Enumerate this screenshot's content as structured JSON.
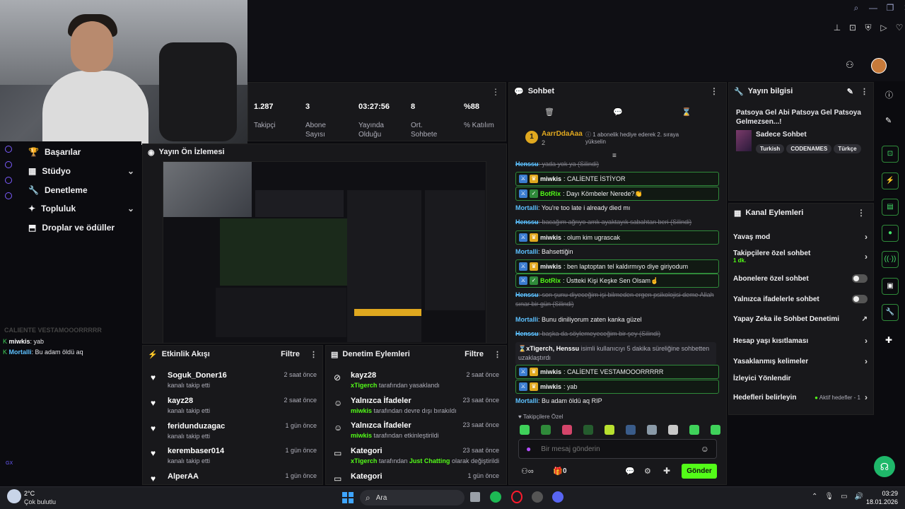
{
  "stats": [
    {
      "value": "1.287",
      "label": "Takipçi"
    },
    {
      "value": "3",
      "label": "Abone Sayısı"
    },
    {
      "value": "03:27:56",
      "label": "Yayında Olduğu"
    },
    {
      "value": "8",
      "label": "Ort. Sohbete"
    },
    {
      "value": "%88",
      "label": "% Katılım"
    }
  ],
  "nav": [
    {
      "label": "Başarılar",
      "icon": "trophy-icon"
    },
    {
      "label": "Stüdyo",
      "icon": "studio-icon",
      "chevron": true
    },
    {
      "label": "Denetleme",
      "icon": "wrench-icon"
    },
    {
      "label": "Topluluk",
      "icon": "community-icon",
      "chevron": true
    },
    {
      "label": "Droplar ve ödüller",
      "icon": "drops-icon"
    }
  ],
  "overlay_chat": {
    "faded": "CALIENTE VESTAMOOORRRRR",
    "lines": [
      {
        "name": "miwkis",
        "text": ": yab"
      },
      {
        "name": "Mortalli",
        "text": ": Bu adam öldü aq"
      }
    ]
  },
  "preview": {
    "title": "Yayın Ön İzlemesi"
  },
  "activity": {
    "title": "Etkinlik Akışı",
    "filter": "Filtre",
    "items": [
      {
        "name": "Soguk_Doner16",
        "sub": "kanalı takip etti",
        "time": "2 saat önce"
      },
      {
        "name": "kayz28",
        "sub": "kanalı takip etti",
        "time": "2 saat önce"
      },
      {
        "name": "feridunduzagac",
        "sub": "kanalı takip etti",
        "time": "1 gün önce"
      },
      {
        "name": "kerembaser014",
        "sub": "kanalı takip etti",
        "time": "1 gün önce"
      },
      {
        "name": "AlperAA",
        "sub": "",
        "time": "1 gün önce"
      }
    ]
  },
  "moderation": {
    "title": "Denetim Eylemleri",
    "filter": "Filtre",
    "items": [
      {
        "name": "kayz28",
        "actor": "xTigerch",
        "sub": "tarafından yasaklandı",
        "time": "2 saat önce"
      },
      {
        "name": "Yalnızca İfadeler",
        "actor": "miwkis",
        "sub": "tarafından devre dışı bırakıldı",
        "time": "23 saat önce"
      },
      {
        "name": "Yalnızca İfadeler",
        "actor": "miwkis",
        "sub": "tarafından etkinleştirildi",
        "time": "23 saat önce"
      },
      {
        "name": "Kategori",
        "actor": "xTigerch",
        "sub": "tarafından",
        "extra": "Just Chatting",
        "tail": "olarak değiştirildi",
        "time": "23 saat önce"
      },
      {
        "name": "Kategori",
        "actor": "",
        "sub": "",
        "time": "1 gün önce"
      }
    ]
  },
  "chat": {
    "title": "Sohbet",
    "pinned_user": "AarrDdaAaa",
    "pinned_count": "2",
    "pinned_msg": "1 abonelik hediye ederek 2. sıraya yükselin",
    "messages": [
      {
        "type": "deleted",
        "name": "Henssu",
        "text": ": yada yok ya (Silindi)"
      },
      {
        "type": "box",
        "name": "miwkis",
        "text": ": CALİENTE İSTİYOR"
      },
      {
        "type": "box",
        "name": "BotRix",
        "text": ": Dayı Kömbeler Nerede?👏"
      },
      {
        "type": "plain",
        "name": "Mortalli",
        "text": ": You're too late i already died mı"
      },
      {
        "type": "deleted",
        "name": "Henssu",
        "text": ": bacağım ağrıyo amk ayaktayık sabahtan beri (Silindi)"
      },
      {
        "type": "box",
        "name": "miwkis",
        "text": ": olum kim ugrascak"
      },
      {
        "type": "plain",
        "name": "Mortalli",
        "text": ": Bahsettiğin"
      },
      {
        "type": "box",
        "name": "miwkis",
        "text": ": ben laptoptan tel kaldırmıyo diye giriyodum"
      },
      {
        "type": "box",
        "name": "BotRix",
        "text": ": Üstteki Kişi Keşke Sen Olsam☝"
      },
      {
        "type": "deleted",
        "name": "Henssu",
        "text": ": son şunu diyeceğim işi bilmeden ergen psikolojisi deme Allah sınar bir gün (Silindi)"
      },
      {
        "type": "plain",
        "name": "Mortalli",
        "text": ": Bunu diniliyorum zaten kanka güzel"
      },
      {
        "type": "deleted",
        "name": "Henssu",
        "text": ": başka da söylemeyeceğim bir şey (Silindi)"
      },
      {
        "type": "system",
        "name": "xTigerch, Henssu",
        "text": " isimli kullanıcıyı 5 dakika süreliğine sohbetten uzaklaştırdı"
      },
      {
        "type": "box",
        "name": "miwkis",
        "text": ": CALİENTE VESTAMOOORRRRR"
      },
      {
        "type": "box",
        "name": "miwkis",
        "text": ": yab"
      },
      {
        "type": "plain",
        "name": "Mortalli",
        "text": ": Bu adam öldü aq RIP"
      }
    ],
    "followers_only": "Takipçilere Özel",
    "placeholder": "Bir mesaj gönderin",
    "points": "0",
    "send": "Gönder"
  },
  "stream_info": {
    "title": "Yayın bilgisi",
    "stream_title": "Patsoya Gel Abi Patsoya Gel Patsoya Gelmezsen...!",
    "category": "Sadece Sohbet",
    "tags": [
      "Turkish",
      "CODENAMES",
      "Türkçe"
    ]
  },
  "channel_actions": {
    "title": "Kanal Eylemleri",
    "items": [
      {
        "label": "Yavaş mod",
        "kind": "chevron"
      },
      {
        "label": "Takipçilere özel sohbet",
        "sub": "1 dk.",
        "kind": "chevron"
      },
      {
        "label": "Abonelere özel sohbet",
        "kind": "toggle"
      },
      {
        "label": "Yalnızca ifadelerle sohbet",
        "kind": "toggle"
      },
      {
        "label": "Yapay Zeka ile Sohbet Denetimi",
        "kind": "external"
      },
      {
        "label": "Hesap yaşı kısıtlaması",
        "kind": "chevron"
      },
      {
        "label": "Yasaklanmış kelimeler",
        "kind": "chevron"
      },
      {
        "label": "İzleyici Yönlendir",
        "kind": "none"
      },
      {
        "label": "Hedefleri belirleyin",
        "extra": "Aktif hedefler - 1",
        "kind": "chevron"
      }
    ]
  },
  "taskbar": {
    "temp": "2°C",
    "weather": "Çok bulutlu",
    "search": "Ara",
    "time": "03:29",
    "date": "18.01.2026"
  },
  "colors": {
    "accent": "#53fc18",
    "panel": "#18181b",
    "bg": "#0b0b0f",
    "kick_green": "#45e36b"
  }
}
